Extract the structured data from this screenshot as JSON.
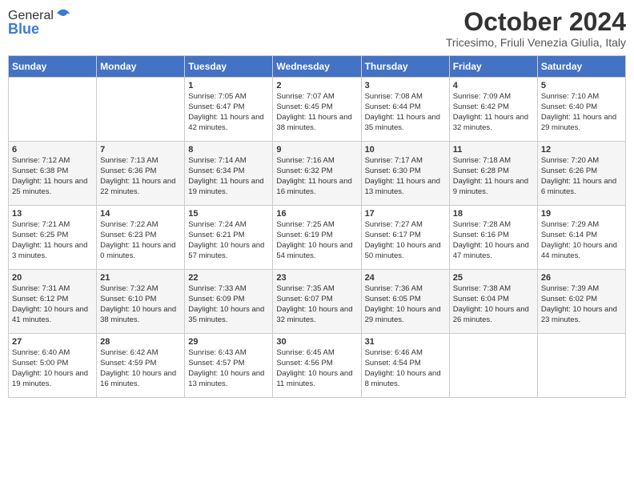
{
  "header": {
    "logo_line1": "General",
    "logo_line2": "Blue",
    "month_title": "October 2024",
    "location": "Tricesimo, Friuli Venezia Giulia, Italy"
  },
  "days_of_week": [
    "Sunday",
    "Monday",
    "Tuesday",
    "Wednesday",
    "Thursday",
    "Friday",
    "Saturday"
  ],
  "weeks": [
    [
      {
        "day": "",
        "info": ""
      },
      {
        "day": "",
        "info": ""
      },
      {
        "day": "1",
        "info": "Sunrise: 7:05 AM\nSunset: 6:47 PM\nDaylight: 11 hours and 42 minutes."
      },
      {
        "day": "2",
        "info": "Sunrise: 7:07 AM\nSunset: 6:45 PM\nDaylight: 11 hours and 38 minutes."
      },
      {
        "day": "3",
        "info": "Sunrise: 7:08 AM\nSunset: 6:44 PM\nDaylight: 11 hours and 35 minutes."
      },
      {
        "day": "4",
        "info": "Sunrise: 7:09 AM\nSunset: 6:42 PM\nDaylight: 11 hours and 32 minutes."
      },
      {
        "day": "5",
        "info": "Sunrise: 7:10 AM\nSunset: 6:40 PM\nDaylight: 11 hours and 29 minutes."
      }
    ],
    [
      {
        "day": "6",
        "info": "Sunrise: 7:12 AM\nSunset: 6:38 PM\nDaylight: 11 hours and 25 minutes."
      },
      {
        "day": "7",
        "info": "Sunrise: 7:13 AM\nSunset: 6:36 PM\nDaylight: 11 hours and 22 minutes."
      },
      {
        "day": "8",
        "info": "Sunrise: 7:14 AM\nSunset: 6:34 PM\nDaylight: 11 hours and 19 minutes."
      },
      {
        "day": "9",
        "info": "Sunrise: 7:16 AM\nSunset: 6:32 PM\nDaylight: 11 hours and 16 minutes."
      },
      {
        "day": "10",
        "info": "Sunrise: 7:17 AM\nSunset: 6:30 PM\nDaylight: 11 hours and 13 minutes."
      },
      {
        "day": "11",
        "info": "Sunrise: 7:18 AM\nSunset: 6:28 PM\nDaylight: 11 hours and 9 minutes."
      },
      {
        "day": "12",
        "info": "Sunrise: 7:20 AM\nSunset: 6:26 PM\nDaylight: 11 hours and 6 minutes."
      }
    ],
    [
      {
        "day": "13",
        "info": "Sunrise: 7:21 AM\nSunset: 6:25 PM\nDaylight: 11 hours and 3 minutes."
      },
      {
        "day": "14",
        "info": "Sunrise: 7:22 AM\nSunset: 6:23 PM\nDaylight: 11 hours and 0 minutes."
      },
      {
        "day": "15",
        "info": "Sunrise: 7:24 AM\nSunset: 6:21 PM\nDaylight: 10 hours and 57 minutes."
      },
      {
        "day": "16",
        "info": "Sunrise: 7:25 AM\nSunset: 6:19 PM\nDaylight: 10 hours and 54 minutes."
      },
      {
        "day": "17",
        "info": "Sunrise: 7:27 AM\nSunset: 6:17 PM\nDaylight: 10 hours and 50 minutes."
      },
      {
        "day": "18",
        "info": "Sunrise: 7:28 AM\nSunset: 6:16 PM\nDaylight: 10 hours and 47 minutes."
      },
      {
        "day": "19",
        "info": "Sunrise: 7:29 AM\nSunset: 6:14 PM\nDaylight: 10 hours and 44 minutes."
      }
    ],
    [
      {
        "day": "20",
        "info": "Sunrise: 7:31 AM\nSunset: 6:12 PM\nDaylight: 10 hours and 41 minutes."
      },
      {
        "day": "21",
        "info": "Sunrise: 7:32 AM\nSunset: 6:10 PM\nDaylight: 10 hours and 38 minutes."
      },
      {
        "day": "22",
        "info": "Sunrise: 7:33 AM\nSunset: 6:09 PM\nDaylight: 10 hours and 35 minutes."
      },
      {
        "day": "23",
        "info": "Sunrise: 7:35 AM\nSunset: 6:07 PM\nDaylight: 10 hours and 32 minutes."
      },
      {
        "day": "24",
        "info": "Sunrise: 7:36 AM\nSunset: 6:05 PM\nDaylight: 10 hours and 29 minutes."
      },
      {
        "day": "25",
        "info": "Sunrise: 7:38 AM\nSunset: 6:04 PM\nDaylight: 10 hours and 26 minutes."
      },
      {
        "day": "26",
        "info": "Sunrise: 7:39 AM\nSunset: 6:02 PM\nDaylight: 10 hours and 23 minutes."
      }
    ],
    [
      {
        "day": "27",
        "info": "Sunrise: 6:40 AM\nSunset: 5:00 PM\nDaylight: 10 hours and 19 minutes."
      },
      {
        "day": "28",
        "info": "Sunrise: 6:42 AM\nSunset: 4:59 PM\nDaylight: 10 hours and 16 minutes."
      },
      {
        "day": "29",
        "info": "Sunrise: 6:43 AM\nSunset: 4:57 PM\nDaylight: 10 hours and 13 minutes."
      },
      {
        "day": "30",
        "info": "Sunrise: 6:45 AM\nSunset: 4:56 PM\nDaylight: 10 hours and 11 minutes."
      },
      {
        "day": "31",
        "info": "Sunrise: 6:46 AM\nSunset: 4:54 PM\nDaylight: 10 hours and 8 minutes."
      },
      {
        "day": "",
        "info": ""
      },
      {
        "day": "",
        "info": ""
      }
    ]
  ]
}
